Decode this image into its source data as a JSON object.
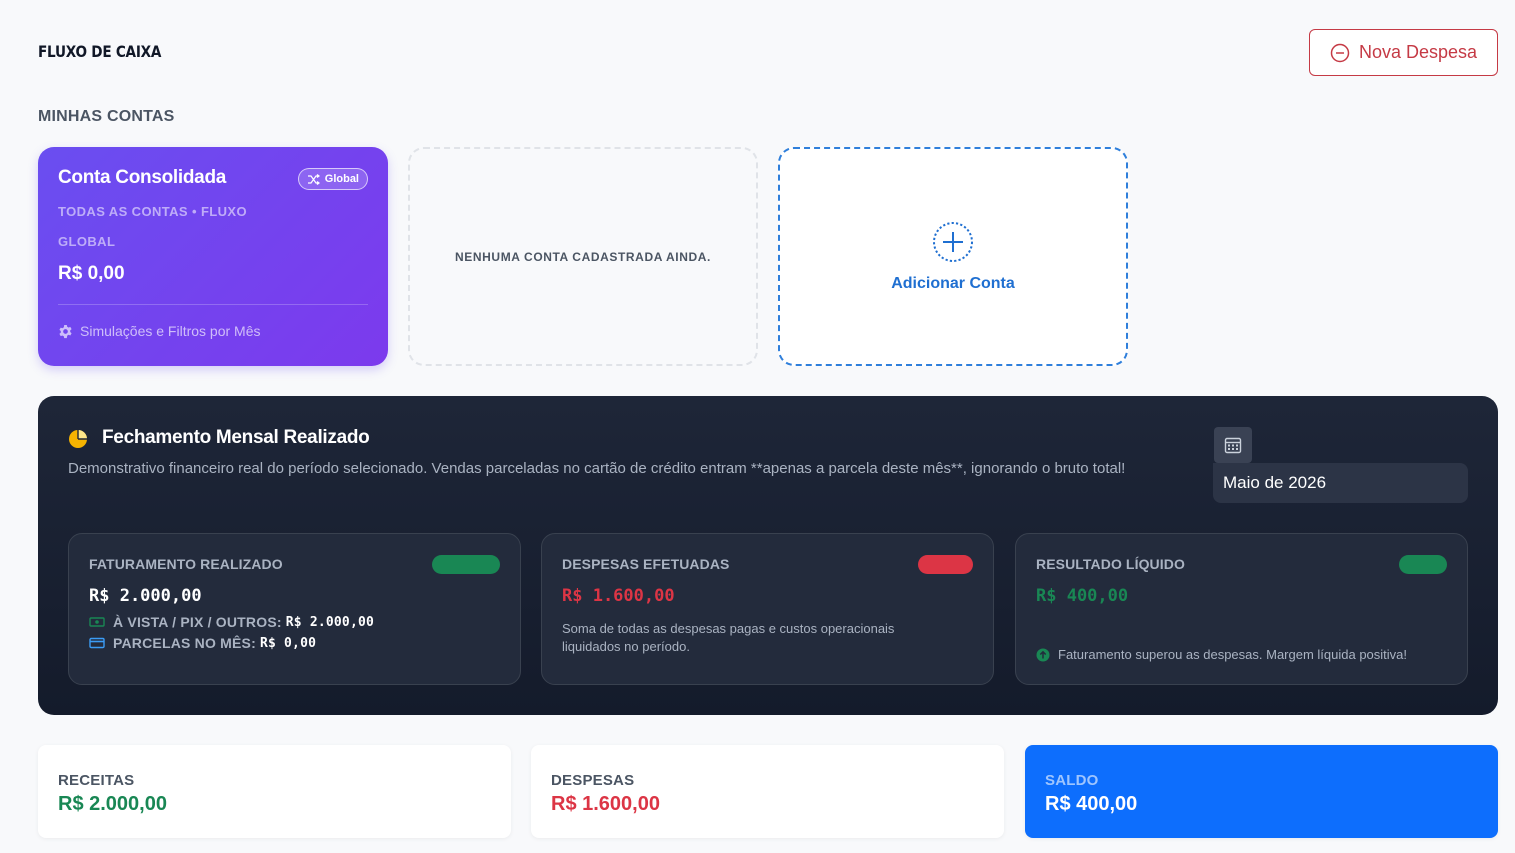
{
  "header": {
    "title": "FLUXO DE CAIXA",
    "new_expense_label": "Nova Despesa"
  },
  "accounts": {
    "section_title": "MINHAS CONTAS",
    "consolidated": {
      "title": "Conta Consolidada",
      "badge": "Global",
      "subtitle": "TODAS AS CONTAS • FLUXO GLOBAL",
      "balance": "R$ 0,00",
      "footer": "Simulações e Filtros por Mês"
    },
    "empty_message": "NENHUMA CONTA CADASTRADA AINDA.",
    "add_label": "Adicionar Conta"
  },
  "monthly": {
    "title": "Fechamento Mensal Realizado",
    "description": "Demonstrativo financeiro real do período selecionado. Vendas parceladas no cartão de crédito entram **apenas a parcela deste mês**, ignorando o bruto total!",
    "month": "Maio de 2026",
    "revenue": {
      "label": "FATURAMENTO REALIZADO",
      "value": "R$ 2.000,00",
      "cash_label": "À VISTA / PIX / OUTROS:",
      "cash_value": "R$ 2.000,00",
      "installments_label": "PARCELAS NO MÊS:",
      "installments_value": "R$ 0,00"
    },
    "expenses": {
      "label": "DESPESAS EFETUADAS",
      "value": "R$ 1.600,00",
      "note": "Soma de todas as despesas pagas e custos operacionais liquidados no período."
    },
    "result": {
      "label": "RESULTADO LÍQUIDO",
      "value": "R$ 400,00",
      "note": "Faturamento superou as despesas. Margem líquida positiva!"
    }
  },
  "summary": {
    "receitas_label": "RECEITAS",
    "receitas_value": "R$ 2.000,00",
    "despesas_label": "DESPESAS",
    "despesas_value": "R$ 1.600,00",
    "saldo_label": "SALDO",
    "saldo_value": "R$ 400,00"
  },
  "colors": {
    "positive": "#198754",
    "negative": "#dc3545",
    "primary": "#0d6efd",
    "purple": "#6a4ef0"
  }
}
